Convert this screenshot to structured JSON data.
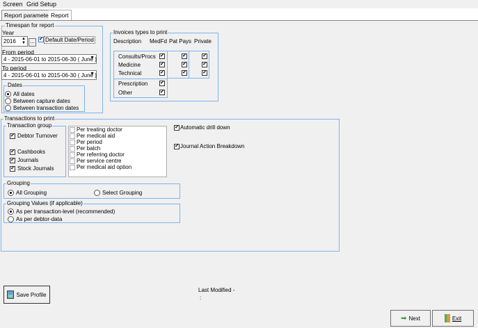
{
  "menu": [
    "Screen",
    "Grid Setup"
  ],
  "tabs": [
    "Report parameters",
    "Report"
  ],
  "timespan": {
    "title": "Timespan for report",
    "year_label": "Year",
    "year": "2016",
    "browse": "...",
    "default_label": "Default Date/Period",
    "from_label": "From period",
    "from_value": "4  - 2015-06-01 to 2015-06-30 ( June )",
    "to_label": "To period",
    "to_value": "4  - 2015-06-01 to 2015-06-30 ( June )"
  },
  "dates": {
    "title": "Dates",
    "options": [
      "All dates",
      "Between capture dates",
      "Between transaction dates"
    ]
  },
  "invoices": {
    "title": "Invoices types to print",
    "headers": [
      "Description",
      "MedFd",
      "Pat Pays",
      "Private"
    ],
    "rows": [
      "Consults/Procs",
      "Medicine",
      "Technical",
      "Prescription",
      "Other"
    ]
  },
  "transactions": {
    "title": "Transactions to print",
    "group_title": "Transaction group",
    "groups": [
      "Debtor Turnover",
      "Cashbooks",
      "Journals",
      "Stock Journals"
    ],
    "list": [
      "Per treating doctor",
      "Per medical aid",
      "Per period",
      "Per batch",
      "Per referring doctor",
      "Per service centre",
      "Per medical aid option"
    ],
    "auto_drill": "Automatic drill down",
    "journal_breakdown": "Journal Action Breakdown"
  },
  "grouping": {
    "title": "Grouping",
    "options": [
      "All Grouping",
      "Select Grouping"
    ]
  },
  "grouping_values": {
    "title": "Grouping Values (if applicable)",
    "options": [
      "As per transaction-level (recommended)",
      "As per debtor-data"
    ]
  },
  "footer": {
    "save_profile": "Save Profile",
    "last_modified": "Last Modified -",
    "last_modified_value": ":",
    "next": "Next",
    "exit": "Exit"
  }
}
